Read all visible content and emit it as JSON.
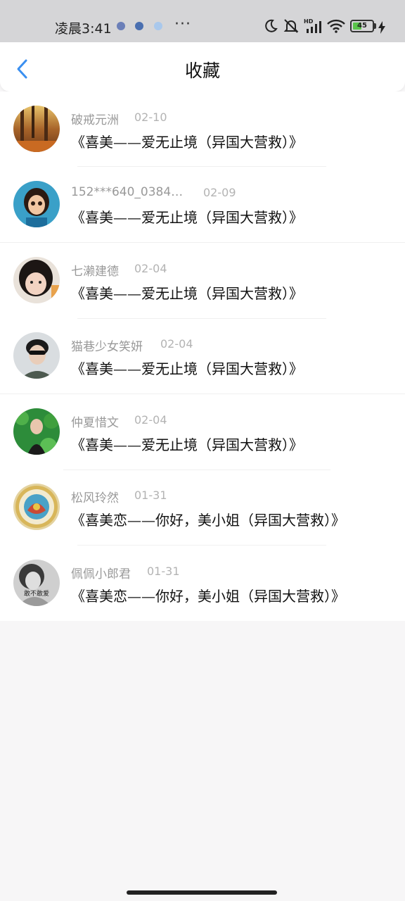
{
  "status_bar": {
    "time": "凌晨3:41",
    "more": "···",
    "battery_level": "45",
    "battery_fraction": 0.45
  },
  "header": {
    "title": "收藏",
    "back_icon": "chevron-left-icon",
    "accent_color": "#3a8ff0"
  },
  "favorites": [
    {
      "user": "破戒元洲",
      "date": "02-10",
      "title": "《喜美——爱无止境（异国大营救）》",
      "avatar": "autumn-forest"
    },
    {
      "user": "152***640_0384…",
      "date": "02-09",
      "title": "《喜美——爱无止境（异国大营救）》",
      "avatar": "cartoon-girl"
    },
    {
      "user": "七濑建德",
      "date": "02-04",
      "title": "《喜美——爱无止境（异国大营救）》",
      "avatar": "girl-face"
    },
    {
      "user": "猫巷少女笑妍",
      "date": "02-04",
      "title": "《喜美——爱无止境（异国大营救）》",
      "avatar": "boy-sunglasses"
    },
    {
      "user": "仲夏惜文",
      "date": "02-04",
      "title": "《喜美——爱无止境（异国大营救）》",
      "avatar": "girl-green-leaves"
    },
    {
      "user": "松风玲然",
      "date": "01-31",
      "title": "《喜美恋——你好，美小姐（异国大营救）》",
      "avatar": "ornate-coin"
    },
    {
      "user": "佩佩小郎君",
      "date": "01-31",
      "title": "《喜美恋——你好，美小姐（异国大营救）》",
      "avatar": "bw-portrait",
      "avatar_text": "敢不敢爱"
    }
  ]
}
